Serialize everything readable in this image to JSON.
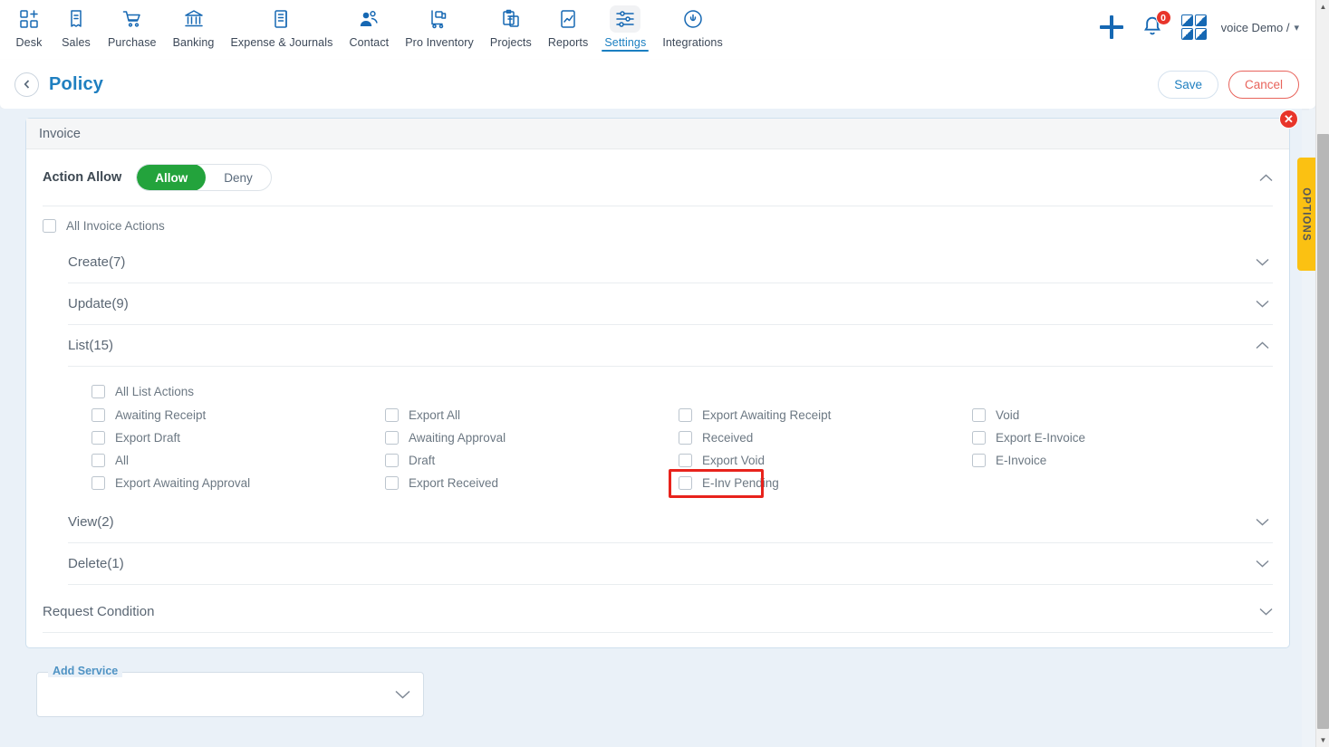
{
  "topnav": {
    "items": [
      {
        "label": "Desk",
        "icon": "apps-add-icon",
        "active": false
      },
      {
        "label": "Sales",
        "icon": "receipt-icon",
        "active": false
      },
      {
        "label": "Purchase",
        "icon": "shopping-cart-icon",
        "active": false
      },
      {
        "label": "Banking",
        "icon": "bank-icon",
        "active": false
      },
      {
        "label": "Expense & Journals",
        "icon": "journal-book-icon",
        "active": false
      },
      {
        "label": "Contact",
        "icon": "people-icon",
        "active": false
      },
      {
        "label": "Pro Inventory",
        "icon": "hand-truck-icon",
        "active": false
      },
      {
        "label": "Projects",
        "icon": "clipboard-icon",
        "active": false
      },
      {
        "label": "Reports",
        "icon": "report-chart-icon",
        "active": false
      },
      {
        "label": "Settings",
        "icon": "sliders-icon",
        "active": true
      },
      {
        "label": "Integrations",
        "icon": "plug-power-icon",
        "active": false
      }
    ],
    "add_button": "add-plus-icon",
    "notifications": {
      "icon": "bell-icon",
      "count": "0"
    },
    "apps_grid": "grid-apps-icon",
    "account": {
      "name": "voice Demo /",
      "caret": "chevron-down-icon"
    }
  },
  "pagebar": {
    "back": "back-chevron-icon",
    "title": "Policy",
    "save_label": "Save",
    "cancel_label": "Cancel"
  },
  "card": {
    "header": "Invoice",
    "close": "close-icon",
    "action_allow": {
      "label": "Action Allow",
      "allow_label": "Allow",
      "deny_label": "Deny",
      "selected": "Allow",
      "chevron": "chevron-up-icon"
    },
    "all_invoice_actions": {
      "label": "All Invoice Actions",
      "checked": false
    },
    "sections": [
      {
        "title": "Create(7)",
        "expanded": false,
        "chevron": "chevron-down-icon"
      },
      {
        "title": "Update(9)",
        "expanded": false,
        "chevron": "chevron-down-icon"
      },
      {
        "title": "List(15)",
        "expanded": true,
        "chevron": "chevron-up-icon"
      },
      {
        "title": "View(2)",
        "expanded": false,
        "chevron": "chevron-down-icon"
      },
      {
        "title": "Delete(1)",
        "expanded": false,
        "chevron": "chevron-down-icon"
      }
    ],
    "list_actions": {
      "all_label": "All List Actions",
      "all_checked": false,
      "rows": [
        [
          {
            "label": "Awaiting Receipt",
            "checked": false,
            "highlighted": false
          },
          {
            "label": "Export All",
            "checked": false,
            "highlighted": false
          },
          {
            "label": "Export Awaiting Receipt",
            "checked": false,
            "highlighted": false
          },
          {
            "label": "Void",
            "checked": false,
            "highlighted": false
          }
        ],
        [
          {
            "label": "Export Draft",
            "checked": false,
            "highlighted": false
          },
          {
            "label": "Awaiting Approval",
            "checked": false,
            "highlighted": false
          },
          {
            "label": "Received",
            "checked": false,
            "highlighted": false
          },
          {
            "label": "Export E-Invoice",
            "checked": false,
            "highlighted": false
          }
        ],
        [
          {
            "label": "All",
            "checked": false,
            "highlighted": false
          },
          {
            "label": "Draft",
            "checked": false,
            "highlighted": false
          },
          {
            "label": "Export Void",
            "checked": false,
            "highlighted": false
          },
          {
            "label": "E-Invoice",
            "checked": false,
            "highlighted": false
          }
        ],
        [
          {
            "label": "Export Awaiting Approval",
            "checked": false,
            "highlighted": false
          },
          {
            "label": "Export Received",
            "checked": false,
            "highlighted": false
          },
          {
            "label": "E-Inv Pending",
            "checked": false,
            "highlighted": true
          },
          {
            "label": "",
            "checked": null,
            "highlighted": false
          }
        ]
      ]
    },
    "request_condition": {
      "title": "Request Condition",
      "chevron": "chevron-down-icon"
    }
  },
  "add_service": {
    "label": "Add Service",
    "value": "",
    "chevron": "chevron-down-icon"
  },
  "options_tab": {
    "label": "OPTIONS"
  },
  "colors": {
    "accent_blue": "#1f7fc0",
    "allow_green": "#23a33c",
    "cancel_red": "#e8645c",
    "badge_red": "#e8352a",
    "highlight_red": "#e8231c",
    "options_yellow": "#fbc112",
    "page_bg": "#eaf1f8"
  }
}
